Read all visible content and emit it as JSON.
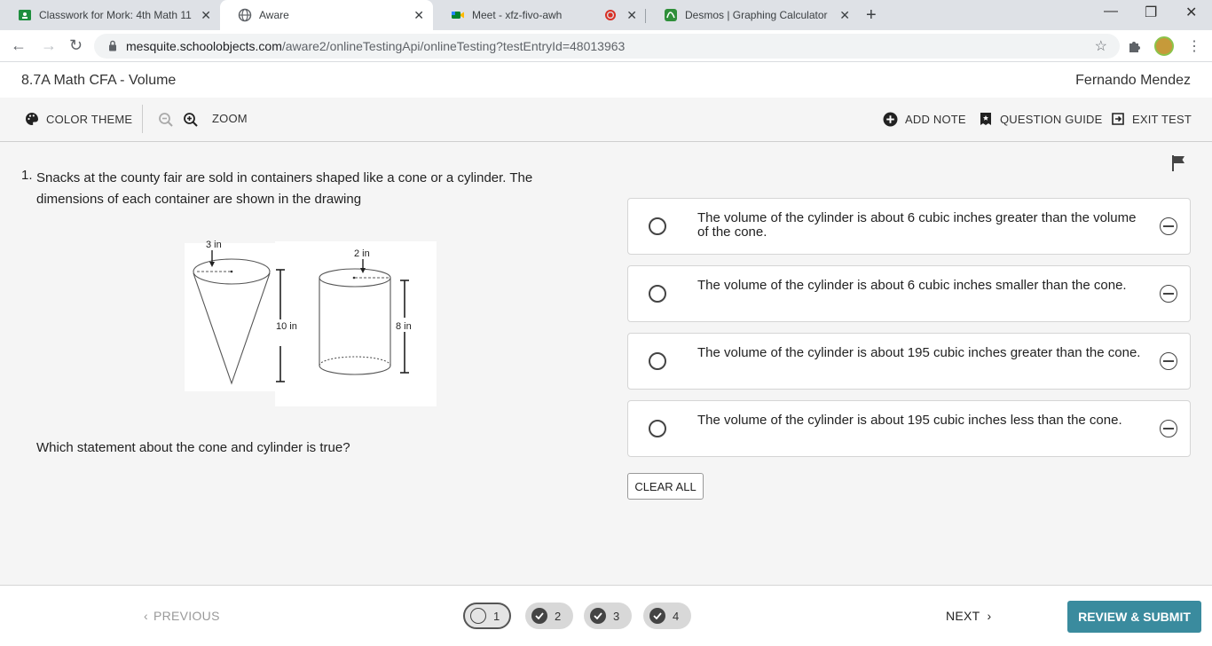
{
  "browser": {
    "tabs": [
      {
        "title": "Classwork for Mork: 4th Math 11",
        "icon": "google-classroom-icon",
        "active": false
      },
      {
        "title": "Aware",
        "icon": "globe-icon",
        "active": true
      },
      {
        "title": "Meet - xfz-fivo-awh",
        "icon": "google-meet-icon",
        "active": false,
        "recording": true
      },
      {
        "title": "Desmos | Graphing Calculator",
        "icon": "desmos-icon",
        "active": false
      }
    ],
    "url_host": "mesquite.schoolobjects.com",
    "url_path": "/aware2/onlineTestingApi/onlineTesting?testEntryId=48013963"
  },
  "app": {
    "test_title": "8.7A Math CFA - Volume",
    "student_name": "Fernando Mendez",
    "accent_color": "#3a8b9e"
  },
  "toolbar": {
    "color_theme": "COLOR THEME",
    "zoom": "ZOOM",
    "add_note": "ADD NOTE",
    "question_guide": "QUESTION GUIDE",
    "exit_test": "EXIT TEST"
  },
  "question": {
    "number": "1.",
    "text": "Snacks at the county fair are sold in containers shaped like a cone or a cylinder. The dimensions of each container are shown in the drawing",
    "prompt": "Which statement about the cone and cylinder is true?",
    "figure": {
      "cone_radius_label": "3 in",
      "cone_height_label": "10 in",
      "cylinder_radius_label": "2 in",
      "cylinder_height_label": "8 in"
    },
    "choices": [
      {
        "text": "The volume of the cylinder is about 6 cubic inches greater than the volume of the cone."
      },
      {
        "text": "The volume of the cylinder is about 6 cubic inches smaller than the cone."
      },
      {
        "text": "The volume of the cylinder is about 195 cubic inches greater than the cone."
      },
      {
        "text": "The volume of the cylinder is about 195 cubic inches less than the cone."
      }
    ],
    "clear_all": "CLEAR ALL"
  },
  "footer": {
    "previous": "PREVIOUS",
    "next": "NEXT",
    "questions": [
      {
        "label": "1",
        "status": "current"
      },
      {
        "label": "2",
        "status": "answered"
      },
      {
        "label": "3",
        "status": "answered"
      },
      {
        "label": "4",
        "status": "answered"
      }
    ],
    "review_submit": "REVIEW & SUBMIT"
  }
}
